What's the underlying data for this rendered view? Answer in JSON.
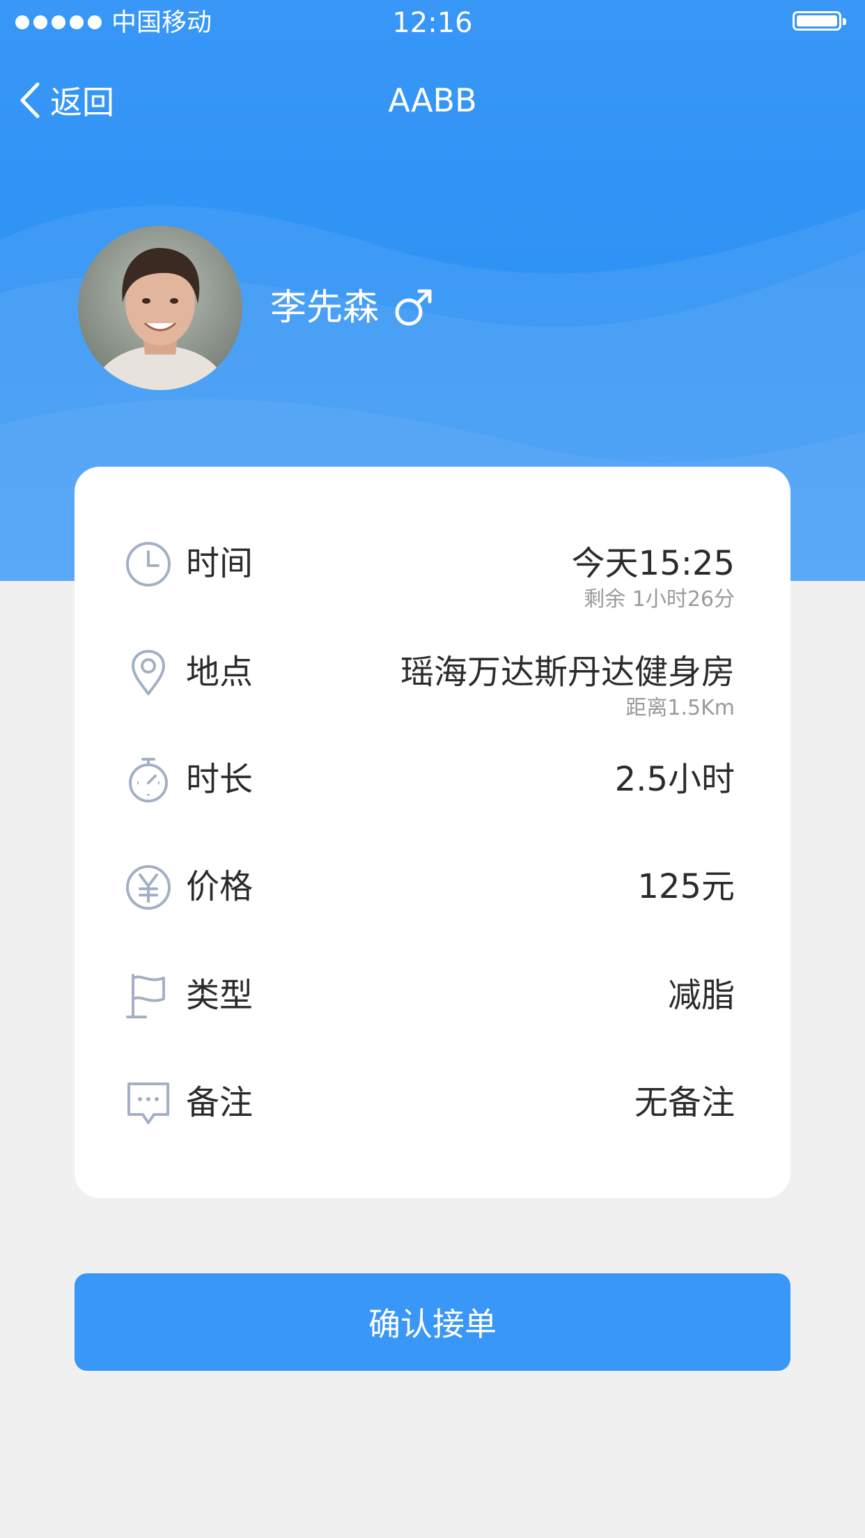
{
  "status_bar": {
    "carrier": "中国移动",
    "time": "12:16"
  },
  "nav": {
    "back_label": "返回",
    "title": "AABB"
  },
  "profile": {
    "name": "李先森",
    "gender_icon": "male-symbol-icon"
  },
  "details": [
    {
      "icon": "clock-icon",
      "label": "时间",
      "value": "今天15:25",
      "sub": "剩余 1小时26分"
    },
    {
      "icon": "location-pin-icon",
      "label": "地点",
      "value": "瑶海万达斯丹达健身房",
      "sub": "距离1.5Km"
    },
    {
      "icon": "stopwatch-icon",
      "label": "时长",
      "value": "2.5小时"
    },
    {
      "icon": "yen-icon",
      "label": "价格",
      "value": "125元"
    },
    {
      "icon": "flag-icon",
      "label": "类型",
      "value": "减脂"
    },
    {
      "icon": "comment-icon",
      "label": "备注",
      "value": "无备注"
    }
  ],
  "confirm_button": "确认接单",
  "colors": {
    "primary": "#3897f7",
    "icon": "#a3b0c4",
    "text": "#2b2b2b",
    "subtext": "#9a9a9a",
    "background": "#f0f0f0"
  }
}
